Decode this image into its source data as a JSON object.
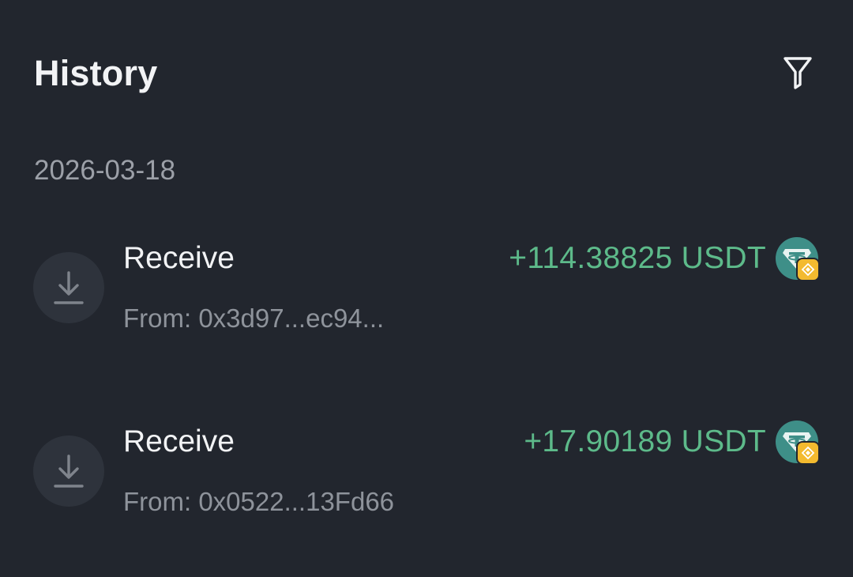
{
  "header": {
    "title": "History",
    "filter_icon": "filter-icon"
  },
  "groups": [
    {
      "date": "2026-03-18",
      "transactions": [
        {
          "type": "Receive",
          "from": "From: 0x3d97...ec94...",
          "amount": "+114.38825 USDT",
          "icon": "download-icon",
          "token_icon": "usdt-icon",
          "chain_icon": "bnb-chain-icon"
        },
        {
          "type": "Receive",
          "from": "From: 0x0522...13Fd66",
          "amount": "+17.90189 USDT",
          "icon": "download-icon",
          "token_icon": "usdt-icon",
          "chain_icon": "bnb-chain-icon"
        }
      ]
    }
  ],
  "colors": {
    "background": "#22262e",
    "amount_positive": "#5dba8a",
    "token_bg": "#3e8f88",
    "chain_badge": "#f3ba2f",
    "secondary_text": "#8e939b"
  }
}
